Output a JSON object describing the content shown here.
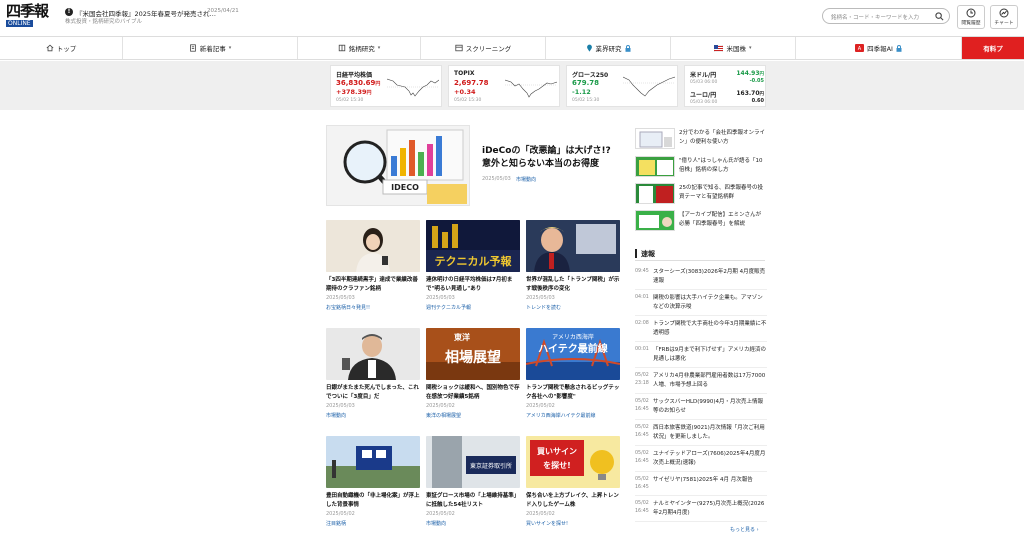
{
  "header": {
    "logo_main": "四季報",
    "logo_sub": "ONLINE",
    "news_headline": "『米国会社四季報』2025年春夏号が発売され…",
    "news_date": "2025/04/21",
    "news_sub": "株式投資・銘柄研究のバイブル",
    "search_placeholder": "銘柄名・コード・キーワードを入力",
    "btn_history": "閲覧履歴",
    "btn_chart": "チャート"
  },
  "nav": {
    "items": [
      "トップ",
      "新着記事",
      "銘柄研究",
      "スクリーニング",
      "業界研究",
      "米国株",
      "四季報AI",
      "有料プ"
    ]
  },
  "markets": {
    "indices": [
      {
        "name": "日経平均株価",
        "value": "36,830.69",
        "unit": "円",
        "change": "+378.39",
        "change_unit": "円",
        "time": "05/02 15:30"
      },
      {
        "name": "TOPIX",
        "value": "2,697.78",
        "change": "+0.34",
        "time": "05/02 15:30"
      },
      {
        "name": "グロース250",
        "value": "679.78",
        "change": "-1.12",
        "time": "05/02 15:30"
      }
    ],
    "fx": [
      {
        "name": "米ドル/円",
        "value": "144.93",
        "unit": "円",
        "change": "-0.05",
        "time": "05/03 06:00"
      },
      {
        "name": "ユーロ/円",
        "value": "163.70",
        "unit": "円",
        "change": "0.60",
        "time": "05/03 06:00"
      }
    ]
  },
  "feature": {
    "title": "iDeCoの「改悪論」は大げさ!? 意外と知らない本当のお得度",
    "date": "2025/05/03",
    "tag": "市場動向",
    "image_text": "IDECO"
  },
  "articles": [
    {
      "title": "「3四半期連続黒字」達成で業績改善期待のクラファン銘柄",
      "date": "2025/05/03",
      "tag": "お宝銘柄日々発見!!"
    },
    {
      "title": "連休明けの日経平均株価は7月初まで\"明るい見通し\"あり",
      "date": "2025/05/03",
      "tag": "週刊テクニカル予報",
      "thumb_text": "テクニカル予報"
    },
    {
      "title": "世界が混乱した「トランプ関税」が示す戦後秩序の変化",
      "date": "2025/05/03",
      "tag": "トレンドを読む"
    },
    {
      "title": "日銀がまたまた死んでしまった、これでついに「3度目」だ",
      "date": "2025/05/03",
      "tag": "市場動向"
    },
    {
      "title": "関税ショックは緩和へ、国別物色で存在感放つ好業績5銘柄",
      "date": "2025/05/02",
      "tag": "東洋の相場展望",
      "thumb_text": "相場展望",
      "thumb_top": "東洋"
    },
    {
      "title": "トランプ関税で懸念されるビッグテック各社への\"影響度\"",
      "date": "2025/05/02",
      "tag": "アメリカ西海岸ハイテク最前線",
      "thumb_text": "ハイテク最前線",
      "thumb_top": "アメリカ西海岸"
    },
    {
      "title": "豊田自動織機の「非上場化案」が浮上した背景事情",
      "date": "2025/05/02",
      "tag": "注目銘柄"
    },
    {
      "title": "東証グロース市場の「上場維持基準」に抵触した54社リスト",
      "date": "2025/05/02",
      "tag": "市場動向",
      "thumb_text": "東京証券取引所"
    },
    {
      "title": "保ち合いを上方ブレイク、上昇トレンド入りしたゲーム株",
      "date": "2025/05/02",
      "tag": "買いサインを探せ!",
      "thumb_text": "買いサインを探せ!"
    }
  ],
  "promos": [
    {
      "text": "2分でわかる「会社四季報オンライン」の便利な使い方"
    },
    {
      "text": "\"億り人\"はっしゃん氏が語る「10倍株」銘柄の探し方"
    },
    {
      "text": "25の記事で知る、四季報春号の投資テーマと有望銘柄群"
    },
    {
      "text": "【アーカイブ配信】エミンさんが必勝「四季報春号」を解説"
    }
  ],
  "flash": {
    "title": "速報",
    "items": [
      {
        "time": "09:45",
        "text": "スターシーズ(3083)2026年2月期 4月度販売速報"
      },
      {
        "time": "04:01",
        "text": "関税の影響は大手ハイテク企業も。アマゾンなどの決算示唆"
      },
      {
        "time": "02:08",
        "text": "トランプ関税で大手商社の今年3月期業績に不透明感"
      },
      {
        "time": "00:01",
        "text": "「FRBは9月まで利下げせず」アメリカ経済の見通しは悪化"
      },
      {
        "time": "05/02 23:18",
        "text": "アメリカ4月非農業部門雇用者数は17万7000人増、市場予想上回る"
      },
      {
        "time": "05/02 16:45",
        "text": "サックスバーHLD(9990)4月・月次売上情報等のお知らせ"
      },
      {
        "time": "05/02 16:45",
        "text": "西日本旅客鉄道(9021)月次情報「月次ご利用状況」を更新しました。"
      },
      {
        "time": "05/02 16:45",
        "text": "ユナイテッドアローズ(7606)2025年4月度月次売上概況(速報)"
      },
      {
        "time": "05/02 16:45",
        "text": "サイゼリヤ(7581)2025年 4月 月次報告"
      },
      {
        "time": "05/02 16:45",
        "text": "ナルミヤインター(9275)月次売上概況(2026年2月期4月度)"
      }
    ],
    "more": "もっと見る"
  }
}
